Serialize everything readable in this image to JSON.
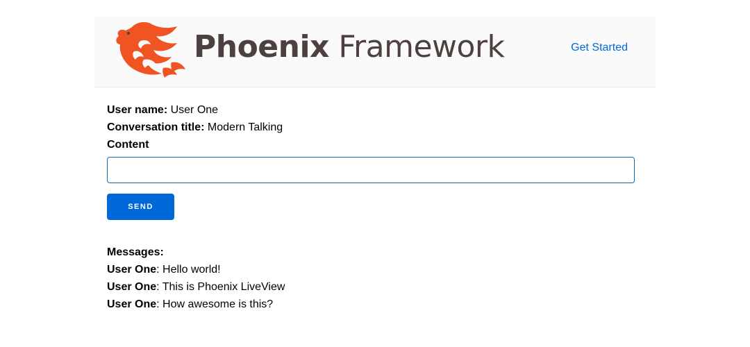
{
  "header": {
    "logo_bold": "Phoenix",
    "logo_light": " Framework",
    "get_started_label": "Get Started"
  },
  "form": {
    "user_name_label": "User name:",
    "user_name_value": " User One",
    "conversation_title_label": "Conversation title:",
    "conversation_title_value": " Modern Talking",
    "content_label": "Content",
    "content_value": "",
    "send_label": "Send"
  },
  "messages": {
    "heading": "Messages:",
    "items": [
      {
        "author": "User One",
        "text": ": Hello world!"
      },
      {
        "author": "User One",
        "text": ": This is Phoenix LiveView"
      },
      {
        "author": "User One",
        "text": ": How awesome is this?"
      }
    ]
  },
  "colors": {
    "accent": "#0069d9",
    "logo_text": "#4d4140",
    "logo_orange": "#f05423",
    "header_bg": "#fafafa"
  },
  "icons": {
    "logo": "phoenix-bird-icon"
  }
}
